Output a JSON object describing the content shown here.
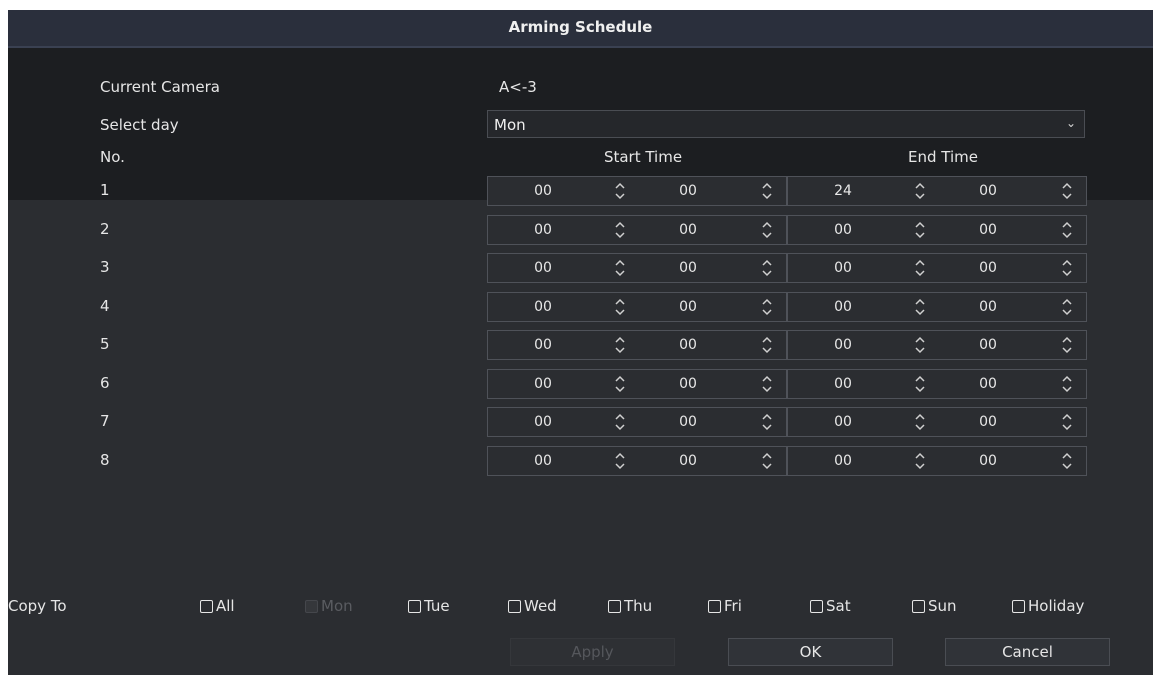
{
  "dialog": {
    "title": "Arming Schedule"
  },
  "current_camera": {
    "label": "Current Camera",
    "value": "A<-3"
  },
  "select_day": {
    "label": "Select day",
    "value": "Mon"
  },
  "columns": {
    "no": "No.",
    "start": "Start Time",
    "end": "End Time"
  },
  "rows": [
    {
      "no": "1",
      "sh": "00",
      "sm": "00",
      "eh": "24",
      "em": "00"
    },
    {
      "no": "2",
      "sh": "00",
      "sm": "00",
      "eh": "00",
      "em": "00"
    },
    {
      "no": "3",
      "sh": "00",
      "sm": "00",
      "eh": "00",
      "em": "00"
    },
    {
      "no": "4",
      "sh": "00",
      "sm": "00",
      "eh": "00",
      "em": "00"
    },
    {
      "no": "5",
      "sh": "00",
      "sm": "00",
      "eh": "00",
      "em": "00"
    },
    {
      "no": "6",
      "sh": "00",
      "sm": "00",
      "eh": "00",
      "em": "00"
    },
    {
      "no": "7",
      "sh": "00",
      "sm": "00",
      "eh": "00",
      "em": "00"
    },
    {
      "no": "8",
      "sh": "00",
      "sm": "00",
      "eh": "00",
      "em": "00"
    }
  ],
  "copy_to": {
    "label": "Copy To",
    "days": [
      {
        "key": "all",
        "label": "All",
        "enabled": true
      },
      {
        "key": "mon",
        "label": "Mon",
        "enabled": false
      },
      {
        "key": "tue",
        "label": "Tue",
        "enabled": true
      },
      {
        "key": "wed",
        "label": "Wed",
        "enabled": true
      },
      {
        "key": "thu",
        "label": "Thu",
        "enabled": true
      },
      {
        "key": "fri",
        "label": "Fri",
        "enabled": true
      },
      {
        "key": "sat",
        "label": "Sat",
        "enabled": true
      },
      {
        "key": "sun",
        "label": "Sun",
        "enabled": true
      },
      {
        "key": "holiday",
        "label": "Holiday",
        "enabled": true
      }
    ]
  },
  "buttons": {
    "apply": "Apply",
    "ok": "OK",
    "cancel": "Cancel"
  },
  "icons": {
    "spinner": "up-down-spinner-icon",
    "dropdown": "chevron-down-icon",
    "checkbox": "checkbox-icon"
  },
  "colors": {
    "background": "#2b2d31",
    "header_band": "#1c1e21",
    "text": "#e6e6e6",
    "disabled": "#5a5c61"
  }
}
